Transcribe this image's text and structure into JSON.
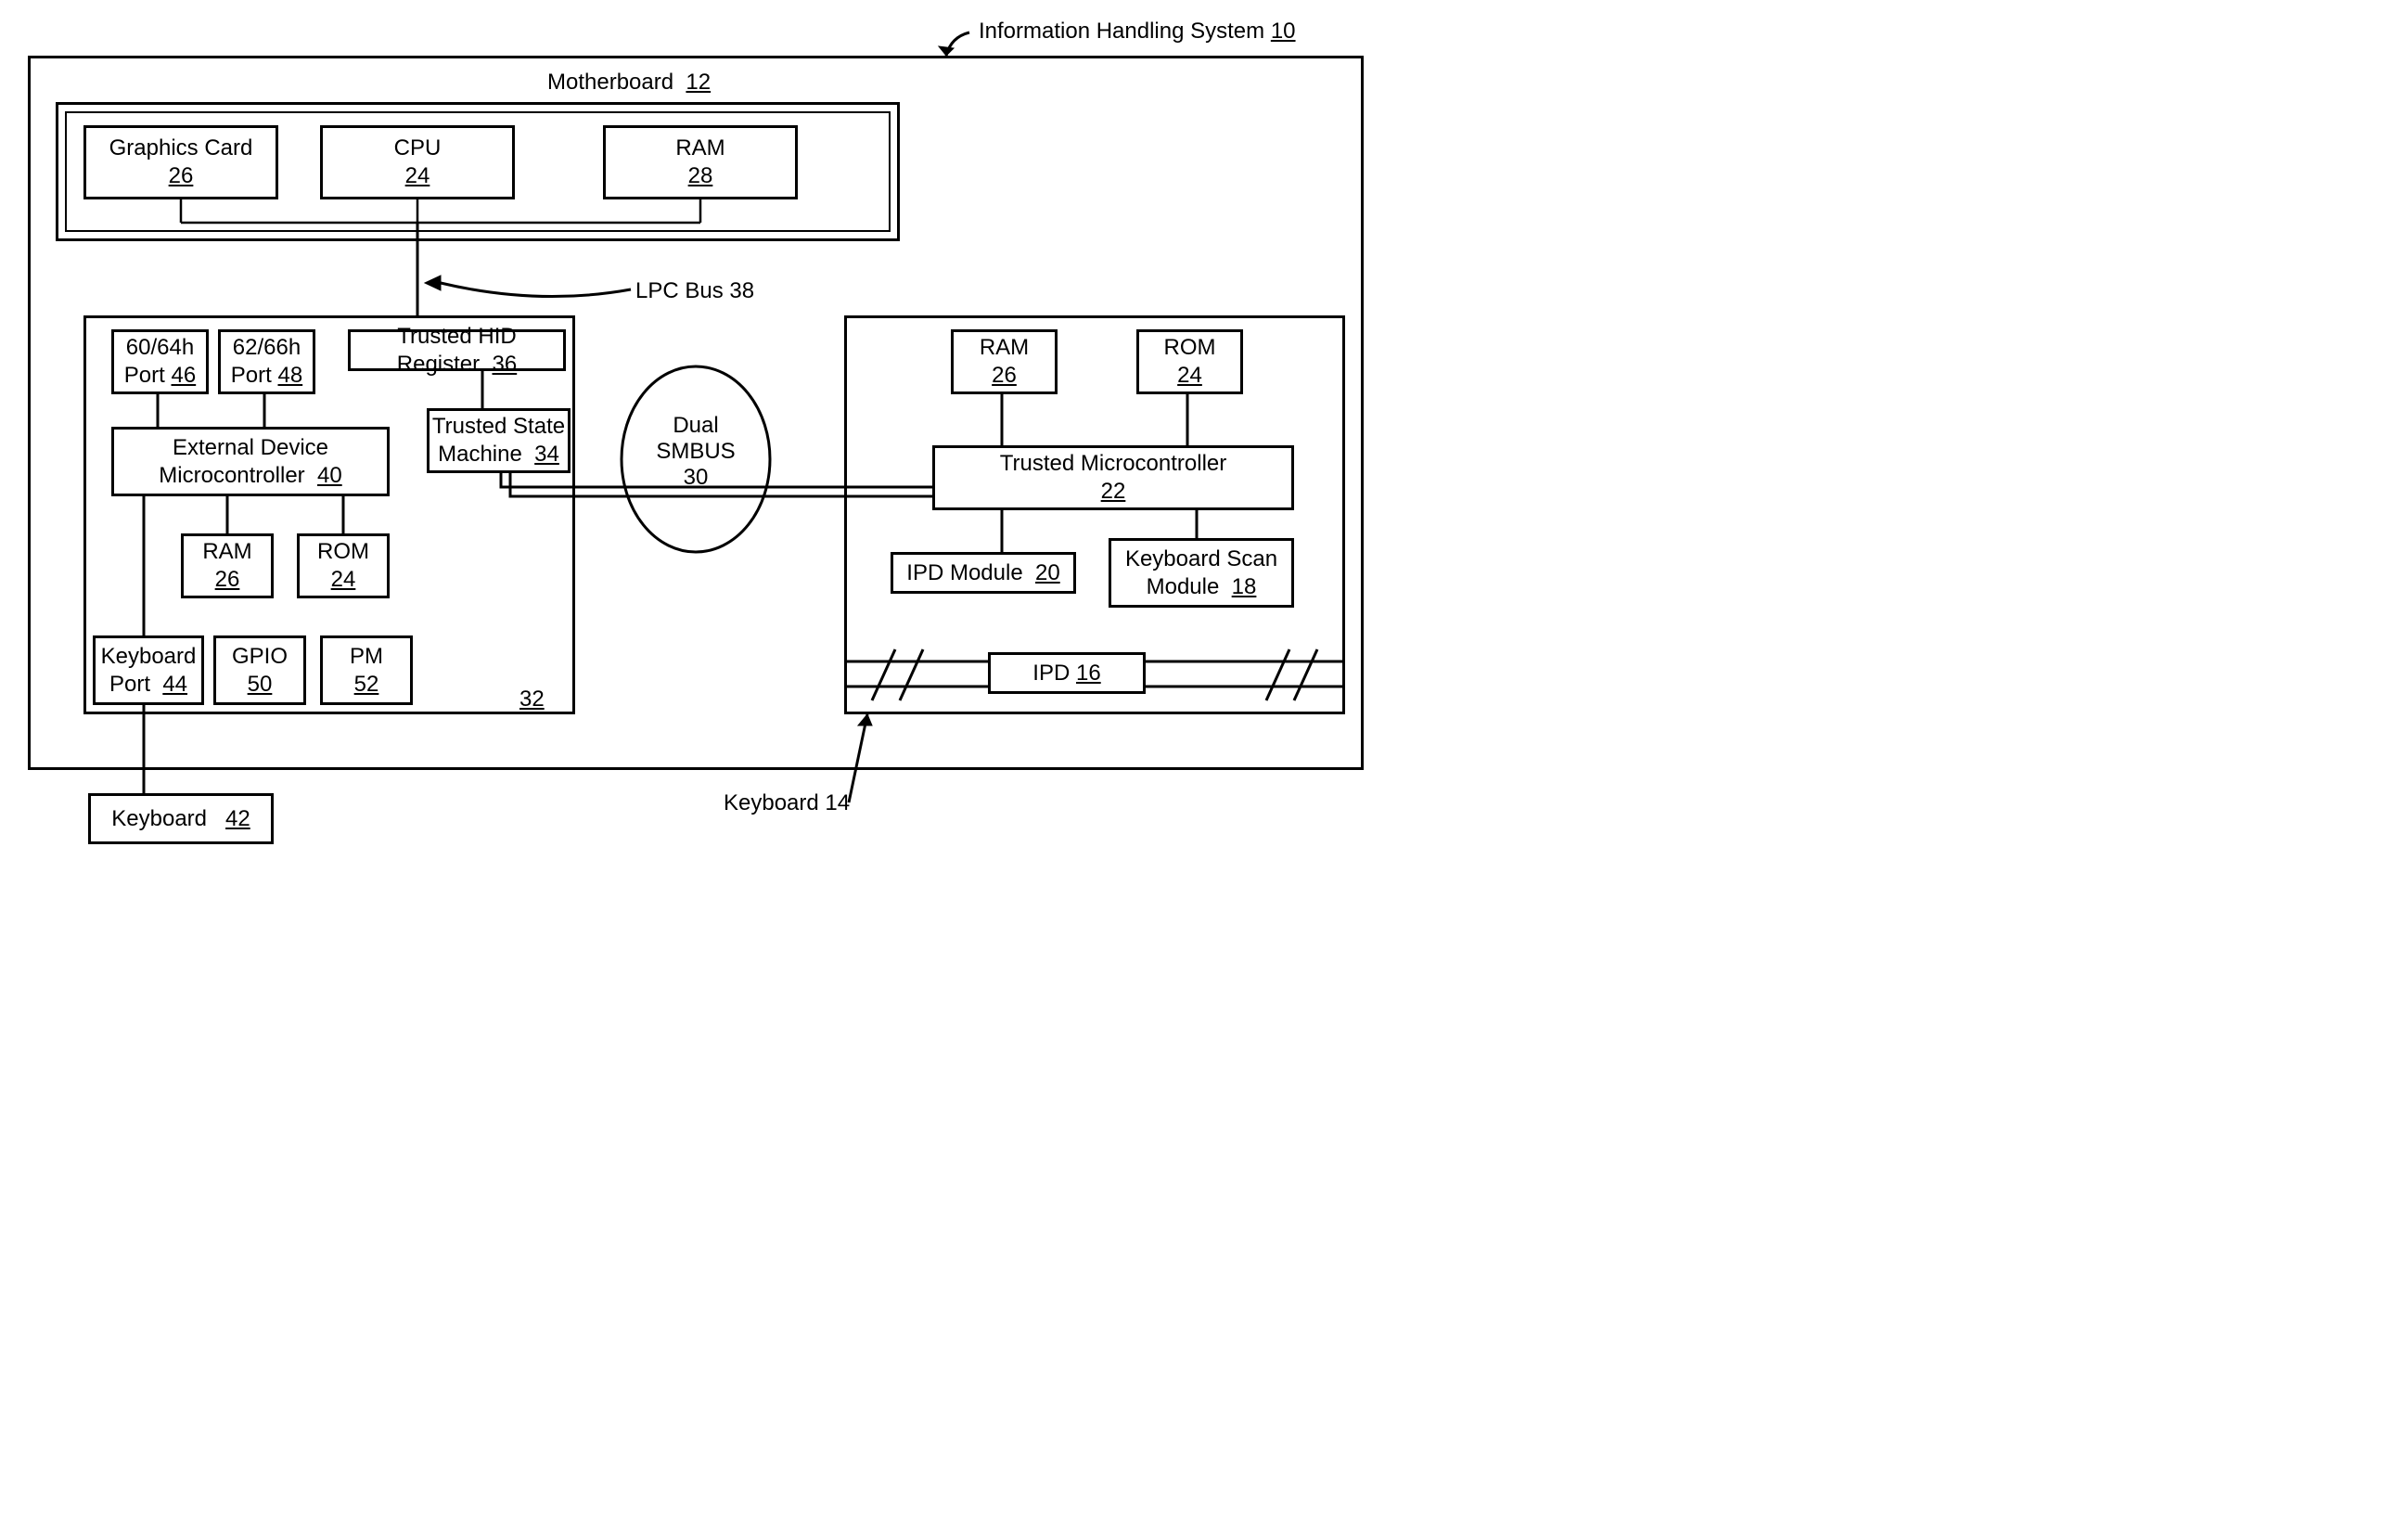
{
  "title": {
    "text": "Information Handling System",
    "num": "10"
  },
  "motherboard": {
    "text": "Motherboard",
    "num": "12"
  },
  "graphics_card": {
    "text": "Graphics Card",
    "num": "26"
  },
  "cpu": {
    "text": "CPU",
    "num": "24"
  },
  "ram_main": {
    "text": "RAM",
    "num": "28"
  },
  "lpc_bus": {
    "text": "LPC Bus 38"
  },
  "port6064": {
    "line1": "60/64h",
    "line2": "Port",
    "num": "46"
  },
  "port6266": {
    "line1": "62/66h",
    "line2": "Port",
    "num": "48"
  },
  "trusted_hid": {
    "text": "Trusted HID Register",
    "num": "36"
  },
  "trusted_state": {
    "line1": "Trusted State",
    "line2": "Machine",
    "num": "34"
  },
  "ext_micro": {
    "line1": "External Device",
    "line2": "Microcontroller",
    "num": "40"
  },
  "ram_left": {
    "text": "RAM",
    "num": "26"
  },
  "rom_left": {
    "text": "ROM",
    "num": "24"
  },
  "kb_port": {
    "line1": "Keyboard",
    "line2": "Port",
    "num": "44"
  },
  "gpio": {
    "text": "GPIO",
    "num": "50"
  },
  "pm": {
    "text": "PM",
    "num": "52"
  },
  "left_block_num": "32",
  "dual_smbus": {
    "line1": "Dual",
    "line2": "SMBUS",
    "num": "30"
  },
  "ram_right": {
    "text": "RAM",
    "num": "26"
  },
  "rom_right": {
    "text": "ROM",
    "num": "24"
  },
  "trusted_micro": {
    "text": "Trusted Microcontroller",
    "num": "22"
  },
  "ipd_module": {
    "text": "IPD Module",
    "num": "20"
  },
  "kb_scan": {
    "line1": "Keyboard Scan",
    "line2": "Module",
    "num": "18"
  },
  "ipd": {
    "text": "IPD",
    "num": "16"
  },
  "keyboard_ext": {
    "text": "Keyboard",
    "num": "42"
  },
  "keyboard_label": {
    "text": "Keyboard 14"
  }
}
